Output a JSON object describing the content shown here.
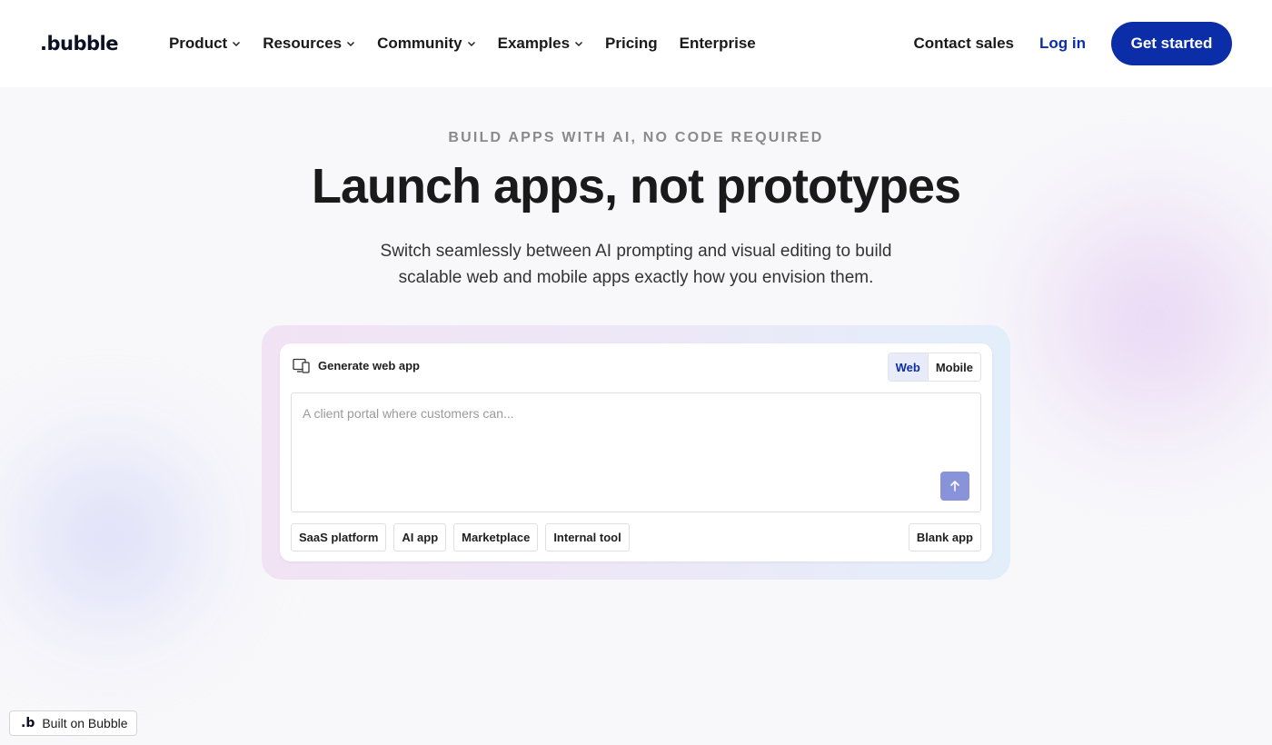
{
  "header": {
    "logo_text": ".bubble",
    "nav": [
      {
        "label": "Product",
        "has_dropdown": true
      },
      {
        "label": "Resources",
        "has_dropdown": true
      },
      {
        "label": "Community",
        "has_dropdown": true
      },
      {
        "label": "Examples",
        "has_dropdown": true
      },
      {
        "label": "Pricing",
        "has_dropdown": false
      },
      {
        "label": "Enterprise",
        "has_dropdown": false
      }
    ],
    "contact_sales": "Contact sales",
    "log_in": "Log in",
    "get_started": "Get started"
  },
  "hero": {
    "eyebrow": "BUILD APPS WITH AI, NO CODE REQUIRED",
    "title": "Launch apps, not prototypes",
    "subtitle": "Switch seamlessly between AI prompting and visual editing to build scalable web and mobile apps exactly how you envision them."
  },
  "generator": {
    "heading": "Generate web app",
    "heading_icon": "device-icon",
    "platform_options": [
      "Web",
      "Mobile"
    ],
    "selected_platform": "Web",
    "prompt_placeholder": "A client portal where customers can...",
    "prompt_value": "",
    "send_icon": "arrow-up-icon",
    "templates": [
      "SaaS platform",
      "AI app",
      "Marketplace",
      "Internal tool"
    ],
    "blank_app": "Blank app"
  },
  "badge": {
    "label": "Built on Bubble",
    "icon_text": ".b"
  },
  "colors": {
    "brand_blue": "#0c2da8",
    "send_button": "#8893d9",
    "page_bg": "#f8f8fb",
    "toggle_active_bg": "#e8ecfa"
  }
}
